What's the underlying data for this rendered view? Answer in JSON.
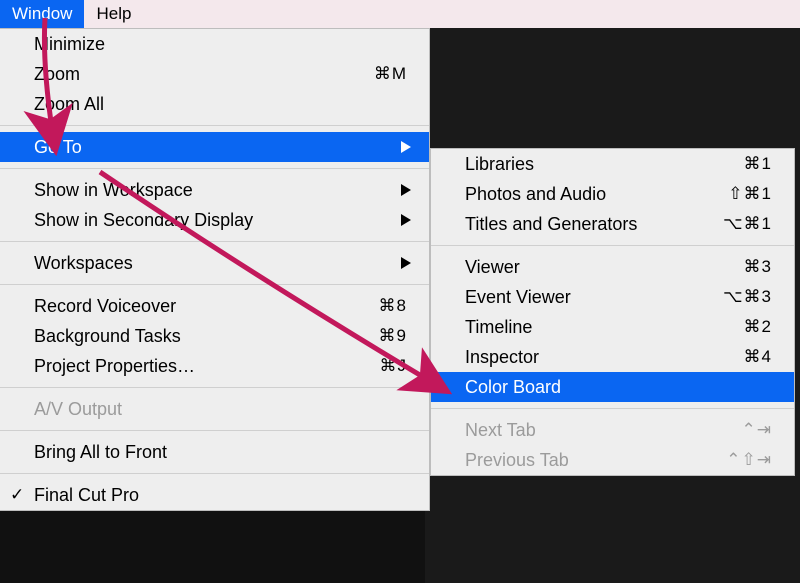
{
  "menubar": {
    "window": "Window",
    "help": "Help"
  },
  "main_menu": {
    "minimize": "Minimize",
    "zoom": "Zoom",
    "zoom_shortcut": "⌘M",
    "zoom_all": "Zoom All",
    "go_to": "Go To",
    "show_workspace": "Show in Workspace",
    "show_secondary": "Show in Secondary Display",
    "workspaces": "Workspaces",
    "record_voiceover": "Record Voiceover",
    "record_voiceover_shortcut": "⌘8",
    "background_tasks": "Background Tasks",
    "background_tasks_shortcut": "⌘9",
    "project_properties": "Project Properties…",
    "project_properties_shortcut": "⌘J",
    "av_output": "A/V Output",
    "bring_all_front": "Bring All to Front",
    "final_cut_pro": "Final Cut Pro"
  },
  "submenu": {
    "libraries": "Libraries",
    "libraries_shortcut": "⌘1",
    "photos_audio": "Photos and Audio",
    "photos_audio_shortcut": "⇧⌘1",
    "titles_generators": "Titles and Generators",
    "titles_generators_shortcut": "⌥⌘1",
    "viewer": "Viewer",
    "viewer_shortcut": "⌘3",
    "event_viewer": "Event Viewer",
    "event_viewer_shortcut": "⌥⌘3",
    "timeline": "Timeline",
    "timeline_shortcut": "⌘2",
    "inspector": "Inspector",
    "inspector_shortcut": "⌘4",
    "color_board": "Color Board",
    "next_tab": "Next Tab",
    "next_tab_shortcut": "⌃⇥",
    "previous_tab": "Previous Tab",
    "previous_tab_shortcut": "⌃⇧⇥"
  },
  "annotation": {
    "color": "#c2185b"
  }
}
